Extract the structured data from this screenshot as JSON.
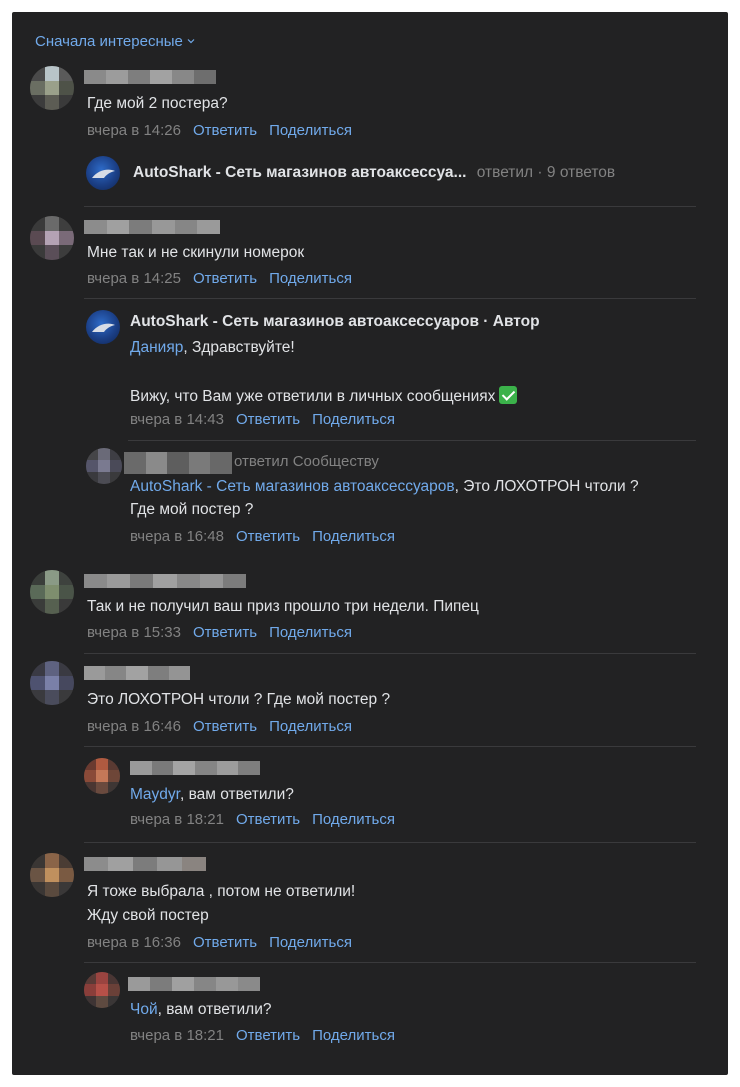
{
  "sort": {
    "label": "Сначала интересные"
  },
  "common": {
    "reply": "Ответить",
    "share": "Поделиться"
  },
  "comments": [
    {
      "text": "Где мой 2 постера?",
      "time": "вчера в 14:26",
      "thread": {
        "author": "AutoShark - Сеть магазинов автоаксессуа...",
        "replied": "ответил",
        "count": "9 ответов"
      }
    },
    {
      "text": "Мне так и не скинули номерок",
      "time": "вчера в 14:25",
      "replies": [
        {
          "author": "AutoShark - Сеть магазинов автоаксессуаров · Автор",
          "mention": "Данияр",
          "line1_rest": ", Здравствуйте!",
          "line2": "Вижу, что Вам уже ответили в личных сообщениях",
          "time": "вчера в 14:43"
        },
        {
          "replied": "ответил Сообществу",
          "mention": "AutoShark - Сеть магазинов автоаксессуаров",
          "line1_rest": ", Это ЛОХОТРОН чтоли ?",
          "line2": "Где мой постер ?",
          "time": "вчера в 16:48"
        }
      ]
    },
    {
      "text": "Так и не получил ваш приз прошло три недели. Пипец",
      "time": "вчера в 15:33"
    },
    {
      "text": "Это ЛОХОТРОН чтоли ? Где мой постер ?",
      "time": "вчера в 16:46",
      "replies": [
        {
          "mention": "Maydyr",
          "line1_rest": ", вам ответили?",
          "time": "вчера в 18:21"
        }
      ]
    },
    {
      "text": "Я тоже выбрала , потом не ответили!",
      "text2": "Жду свой постер",
      "time": "вчера в 16:36",
      "replies": [
        {
          "mention": "Чой",
          "line1_rest": ", вам ответили?",
          "time": "вчера в 18:21"
        }
      ]
    }
  ]
}
